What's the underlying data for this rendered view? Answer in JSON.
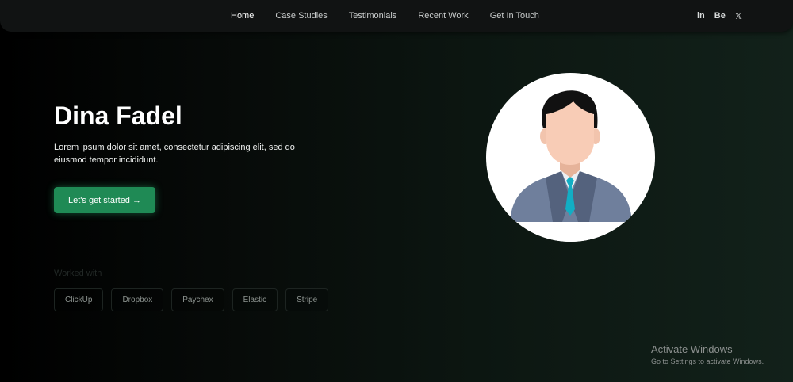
{
  "nav": {
    "links": [
      "Home",
      "Case Studies",
      "Testimonials",
      "Recent Work",
      "Get In Touch"
    ],
    "social": [
      {
        "label": "in",
        "icon": "linkedin-icon"
      },
      {
        "label": "Be",
        "icon": "behance-icon"
      },
      {
        "label": "𝕏",
        "icon": "x-icon"
      }
    ]
  },
  "hero": {
    "title": "Dina Fadel",
    "description": "Lorem ipsum dolor sit amet, consectetur adipiscing elit, sed do eiusmod tempor incididunt.",
    "cta_label": "Let's get started →"
  },
  "worked_with": {
    "label": "Worked with",
    "brands": [
      "ClickUp",
      "Dropbox",
      "Paychex",
      "Elastic",
      "Stripe"
    ]
  },
  "watermark": {
    "title": "Activate Windows",
    "subtitle": "Go to Settings to activate Windows."
  },
  "colors": {
    "accent": "#1f8a55",
    "background": "#000000",
    "nav_background": "#111313"
  }
}
